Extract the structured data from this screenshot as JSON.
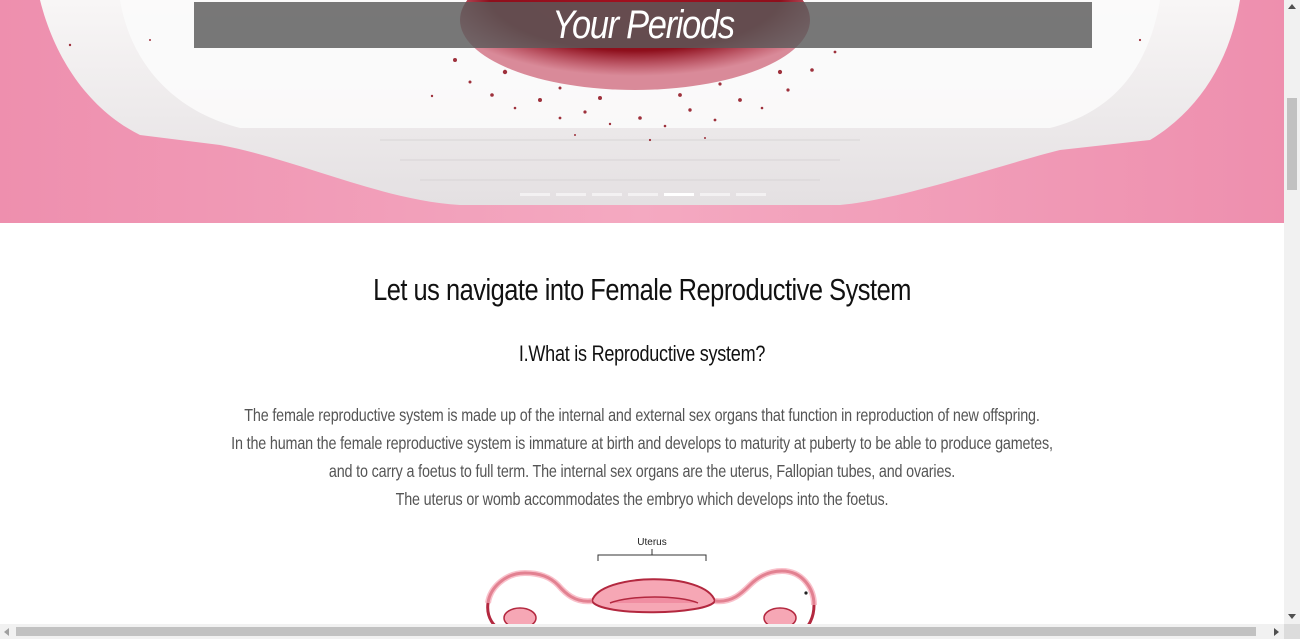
{
  "hero": {
    "caption": "Your Periods",
    "slide_count": 7,
    "active_slide": 5
  },
  "main": {
    "heading": "Let us navigate into Female Reproductive System",
    "section_title": "I.What is Reproductive system?",
    "paragraph_lines": [
      "The female reproductive system is made up of the internal and external sex organs that function in reproduction of new offspring.",
      "In the human the female reproductive system is immature at birth and develops to maturity at puberty to be able to produce gametes,",
      "and to carry a foetus to full term. The internal sex organs are the uterus, Fallopian tubes, and ovaries.",
      "The uterus or womb accommodates the embryo which develops into the foetus."
    ],
    "diagram_label": "Uterus"
  },
  "colors": {
    "hero_pink": "#f19bb5",
    "blood_red": "#8e0f1c",
    "pad_white": "#f3f1f1",
    "diagram_fill": "#f6a7b5",
    "diagram_stroke": "#b3283f"
  }
}
